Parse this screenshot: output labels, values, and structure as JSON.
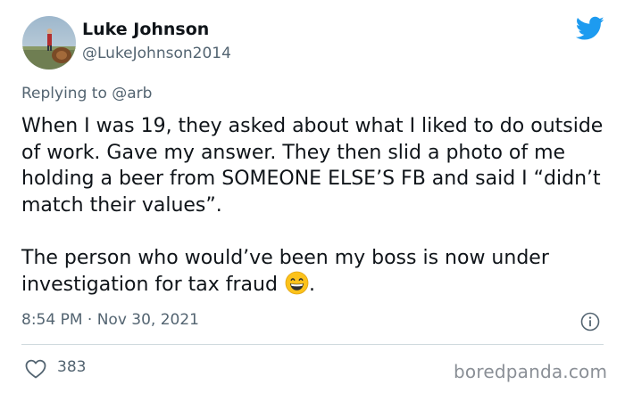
{
  "author": {
    "display_name": "Luke Johnson",
    "handle": "@LukeJohnson2014",
    "avatar_icon": "profile-photo"
  },
  "reply": {
    "prefix": "Replying to",
    "target": "@arb"
  },
  "tweet": {
    "paragraph_1": "When I was 19, they asked about what I liked to do outside of work. Gave my answer. They then slid a photo of me holding a beer from SOMEONE ELSE’S FB and said I “didn’t match their values”.",
    "paragraph_2": "The person who would’ve been my boss is now under investigation for tax fraud",
    "paragraph_2_end": ".",
    "emoji_icon": "grinning-face-emoji"
  },
  "meta": {
    "timestamp": "8:54 PM · Nov 30, 2021",
    "like_count": "383"
  },
  "icons": {
    "brand": "twitter-bird-icon",
    "info": "info-icon",
    "like": "heart-icon"
  },
  "watermark": "boredpanda.com",
  "colors": {
    "brand_blue": "#1d9bf0",
    "text_primary": "#0f1419",
    "text_secondary": "#536471",
    "divider": "#cfd9de"
  }
}
